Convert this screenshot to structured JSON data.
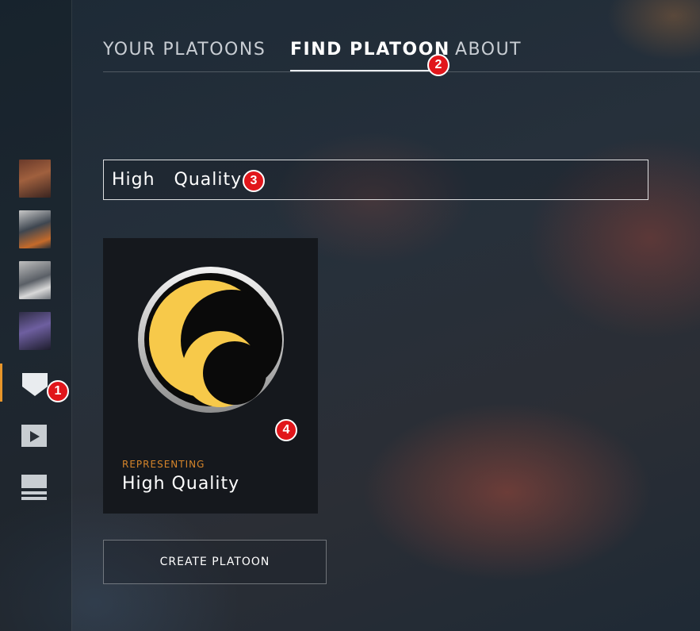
{
  "tabs": [
    {
      "label": "YOUR PLATOONS",
      "active": false
    },
    {
      "label": "FIND PLATOON",
      "active": true
    },
    {
      "label": "ABOUT",
      "active": false
    }
  ],
  "search": {
    "value": "High  Quality"
  },
  "result_card": {
    "label": "REPRESENTING",
    "name": "High Quality",
    "emblem_colors": {
      "ring": "#d9d9d9",
      "inner": "#0a0a0a",
      "moon": "#f7c94a"
    }
  },
  "buttons": {
    "create": "CREATE PLATOON"
  },
  "sidebar": {
    "icons": [
      "soldier-avatar-1",
      "soldier-avatar-2",
      "soldier-avatar-3",
      "soldier-avatar-4",
      "platoon-shield-icon",
      "play-icon",
      "list-icon"
    ],
    "active_index": 4,
    "accent_color": "#e8962a"
  },
  "markers": [
    "1",
    "2",
    "3",
    "4"
  ]
}
